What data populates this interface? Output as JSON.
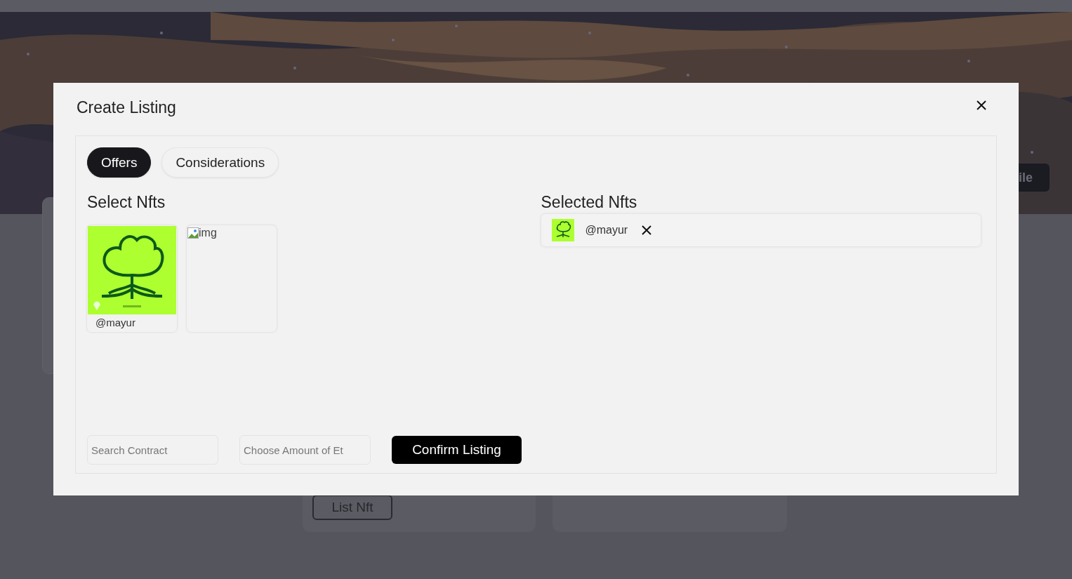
{
  "background": {
    "profile_button": "ile",
    "list_button": "List Nft"
  },
  "dialog": {
    "title": "Create Listing",
    "tabs": [
      {
        "label": "Offers",
        "selected": true
      },
      {
        "label": "Considerations",
        "selected": false
      }
    ],
    "select_heading": "Select Nfts",
    "nfts": [
      {
        "kind": "picture",
        "caption": "@mayur"
      },
      {
        "kind": "broken",
        "alt": "img"
      }
    ],
    "selected_heading": "Selected Nfts",
    "selected_nfts": [
      {
        "name": "@mayur"
      }
    ],
    "search": {
      "placeholder": "Search Contract"
    },
    "amount": {
      "placeholder": "Choose Amount of Et"
    },
    "confirm": "Confirm Listing"
  }
}
